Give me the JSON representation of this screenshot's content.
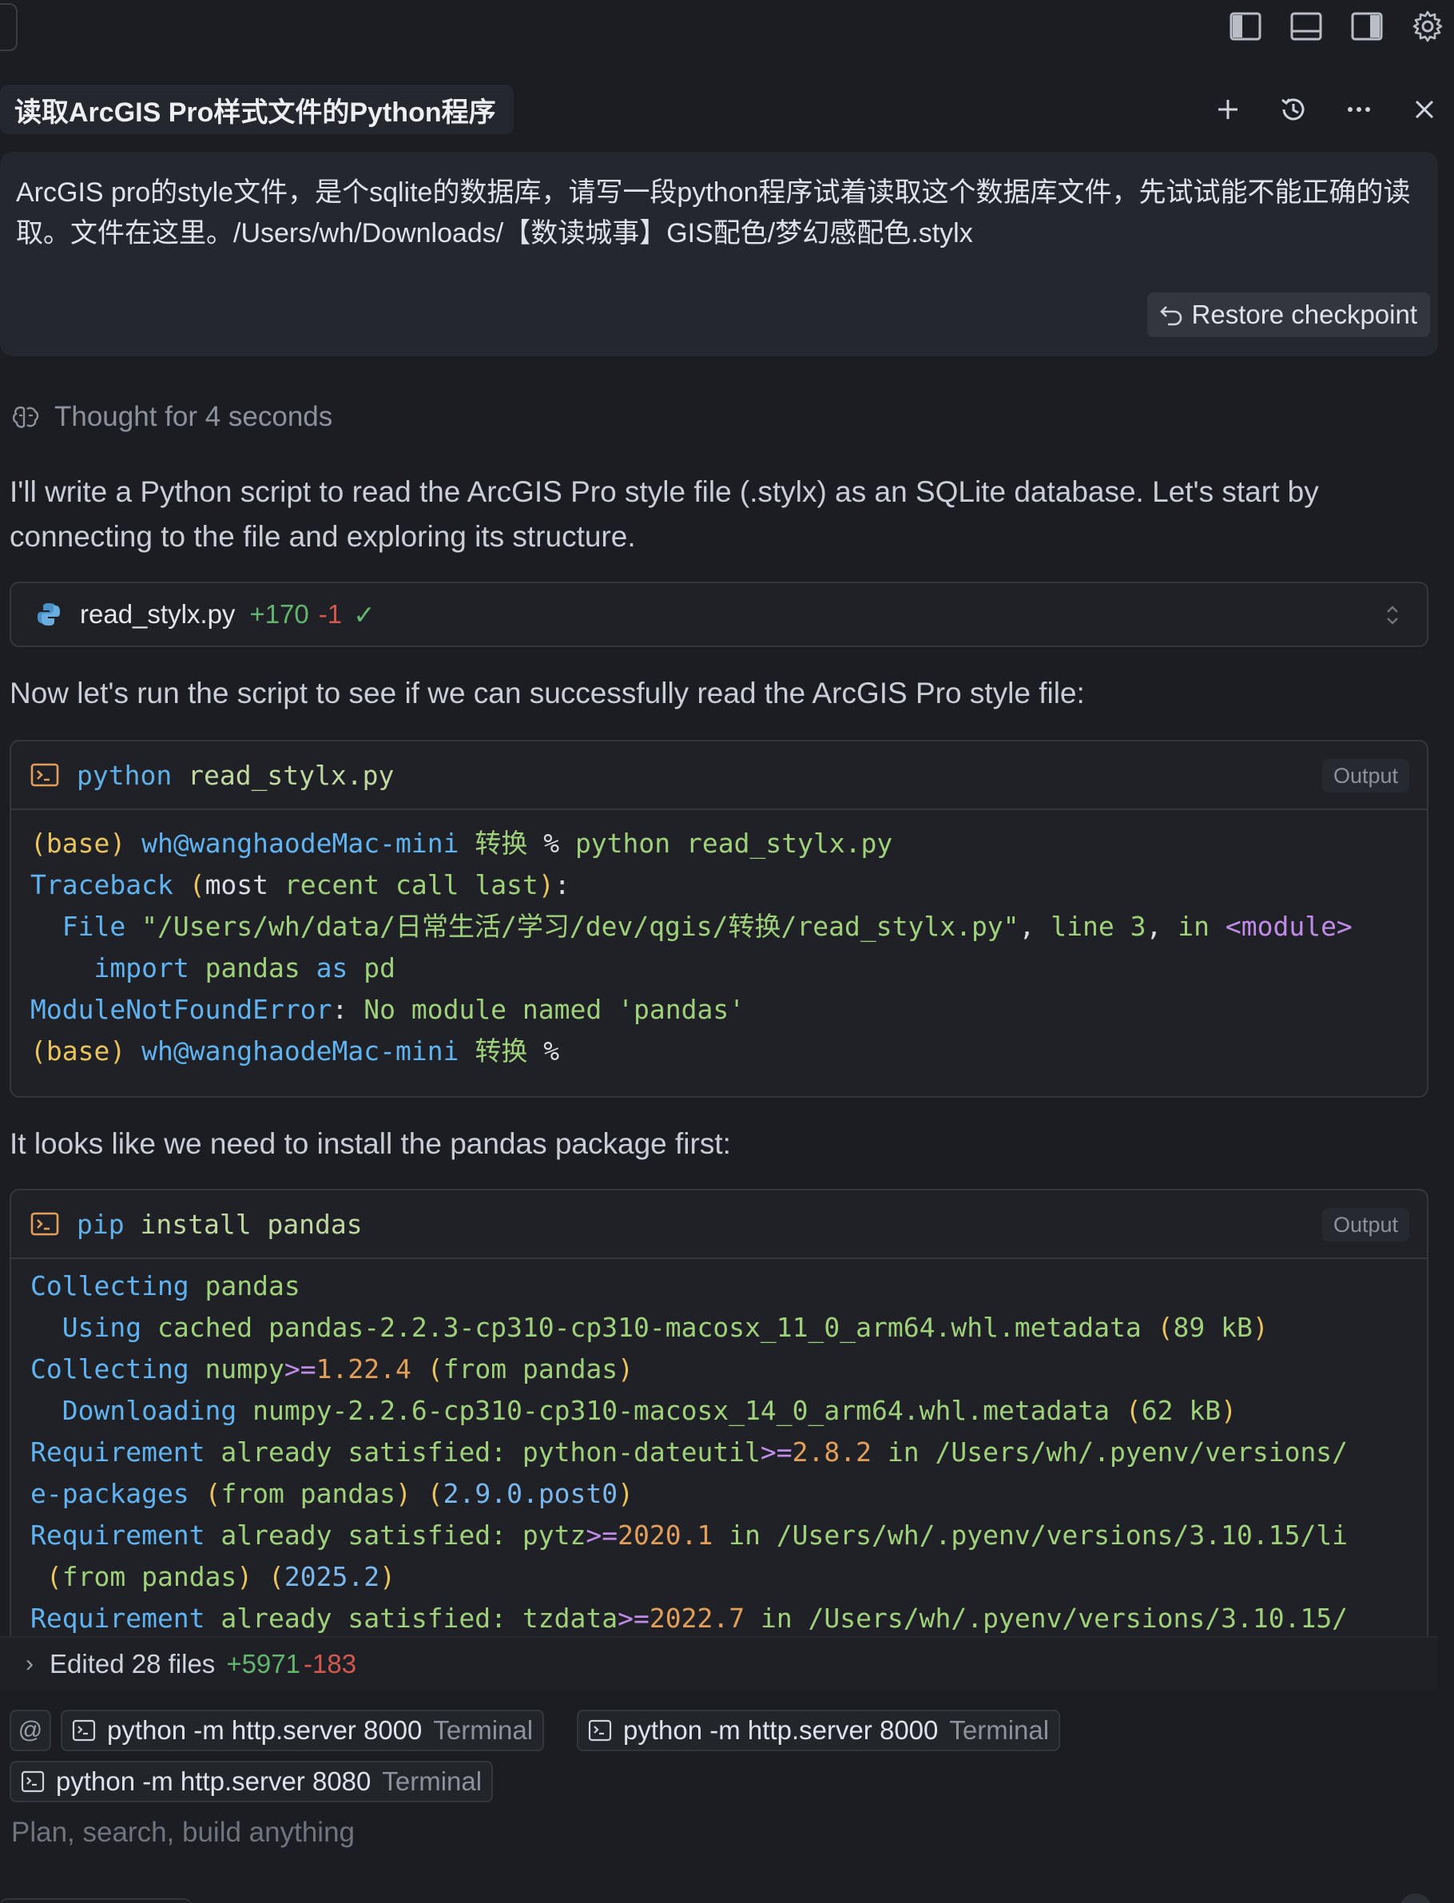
{
  "window": {
    "title": "读取ArcGIS Pro样式文件的Python程序",
    "top_icons": [
      "toggle-left-sidebar-icon",
      "toggle-bottom-panel-icon",
      "toggle-right-sidebar-icon",
      "settings-gear-icon"
    ],
    "title_actions": [
      "plus-icon",
      "history-icon",
      "more-icon",
      "close-icon"
    ]
  },
  "user_message": {
    "text": "ArcGIS pro的style文件，是个sqlite的数据库，请写一段python程序试着读取这个数据库文件，先试试能不能正确的读取。文件在这里。/Users/wh/Downloads/【数读城事】GIS配色/梦幻感配色.stylx",
    "restore_label": "Restore checkpoint"
  },
  "thought": {
    "label": "Thought for 4 seconds"
  },
  "messages": {
    "intro": "I'll write a Python script to read the ArcGIS Pro style file (.stylx) as an SQLite database. Let's start by connecting to the file and exploring its structure.",
    "run": "Now let's run the script to see if we can successfully read the ArcGIS Pro style file:",
    "install": "It looks like we need to install the pandas package first:"
  },
  "file_edit": {
    "name": "read_stylx.py",
    "added": "+170",
    "removed": "-1",
    "check": "✓"
  },
  "terminal1": {
    "command_prog": "python",
    "command_args": "read_stylx.py",
    "output_label": "Output",
    "lines": [
      [
        [
          "t-y",
          "(base)"
        ],
        [
          "t-w",
          " "
        ],
        [
          "t-b",
          "wh@wanghaodeMac-mini"
        ],
        [
          "t-w",
          " "
        ],
        [
          "t-g",
          "转换"
        ],
        [
          "t-w",
          " % "
        ],
        [
          "t-g",
          "python read_stylx.py"
        ]
      ],
      [
        [
          "t-b",
          "Traceback"
        ],
        [
          "t-w",
          " "
        ],
        [
          "t-y",
          "("
        ],
        [
          "t-w",
          "most"
        ],
        [
          "t-g",
          " recent call last"
        ],
        [
          "t-y",
          ")"
        ],
        [
          "t-w",
          ":"
        ]
      ],
      [
        [
          "t-w",
          "  "
        ],
        [
          "t-b",
          "File"
        ],
        [
          "t-g",
          " \"/Users/wh/data/日常生活/学习/dev/qgis/转换/read_stylx.py\""
        ],
        [
          "t-w",
          ","
        ],
        [
          "t-g",
          " line 3"
        ],
        [
          "t-w",
          ","
        ],
        [
          "t-g",
          " in "
        ],
        [
          "t-p",
          "<module>"
        ]
      ],
      [
        [
          "t-w",
          "    "
        ],
        [
          "t-b",
          "import"
        ],
        [
          "t-g",
          " pandas "
        ],
        [
          "t-b",
          "as"
        ],
        [
          "t-g",
          " pd"
        ]
      ],
      [
        [
          "t-b",
          "ModuleNotFoundError"
        ],
        [
          "t-w",
          ":"
        ],
        [
          "t-g",
          " No module named 'pandas'"
        ]
      ],
      [
        [
          "t-y",
          "(base)"
        ],
        [
          "t-w",
          " "
        ],
        [
          "t-b",
          "wh@wanghaodeMac-mini"
        ],
        [
          "t-w",
          " "
        ],
        [
          "t-g",
          "转换"
        ],
        [
          "t-w",
          " %"
        ]
      ]
    ]
  },
  "terminal2": {
    "command_prog": "pip",
    "command_args": "install pandas",
    "output_label": "Output",
    "lines": [
      [
        [
          "t-b",
          "Collecting"
        ],
        [
          "t-g",
          " pandas"
        ]
      ],
      [
        [
          "t-w",
          "  "
        ],
        [
          "t-b",
          "Using"
        ],
        [
          "t-g",
          " cached pandas-2.2.3-cp310-cp310-macosx_11_0_arm64.whl.metadata "
        ],
        [
          "t-y",
          "("
        ],
        [
          "t-g",
          "89 kB"
        ],
        [
          "t-y",
          ")"
        ]
      ],
      [
        [
          "t-b",
          "Collecting"
        ],
        [
          "t-g",
          " numpy"
        ],
        [
          "t-p",
          ">="
        ],
        [
          "t-o",
          "1.22.4"
        ],
        [
          "t-g",
          " "
        ],
        [
          "t-y",
          "("
        ],
        [
          "t-g",
          "from pandas"
        ],
        [
          "t-y",
          ")"
        ]
      ],
      [
        [
          "t-w",
          "  "
        ],
        [
          "t-b",
          "Downloading"
        ],
        [
          "t-g",
          " numpy-2.2.6-cp310-cp310-macosx_14_0_arm64.whl.metadata "
        ],
        [
          "t-y",
          "("
        ],
        [
          "t-g",
          "62 kB"
        ],
        [
          "t-y",
          ")"
        ]
      ],
      [
        [
          "t-b",
          "Requirement"
        ],
        [
          "t-g",
          " already satisfied: python-dateutil"
        ],
        [
          "t-p",
          ">="
        ],
        [
          "t-o",
          "2.8.2"
        ],
        [
          "t-g",
          " in /Users/wh/.pyenv/versions/"
        ]
      ],
      [
        [
          "t-b",
          "e-packages"
        ],
        [
          "t-g",
          " "
        ],
        [
          "t-y",
          "("
        ],
        [
          "t-g",
          "from pandas"
        ],
        [
          "t-y",
          ")"
        ],
        [
          "t-g",
          " "
        ],
        [
          "t-y",
          "("
        ],
        [
          "t-num",
          "2.9.0.post0"
        ],
        [
          "t-y",
          ")"
        ]
      ],
      [
        [
          "t-b",
          "Requirement"
        ],
        [
          "t-g",
          " already satisfied: pytz"
        ],
        [
          "t-p",
          ">="
        ],
        [
          "t-o",
          "2020.1"
        ],
        [
          "t-g",
          " in /Users/wh/.pyenv/versions/3.10.15/li"
        ]
      ],
      [
        [
          "t-w",
          " "
        ],
        [
          "t-y",
          "("
        ],
        [
          "t-g",
          "from pandas"
        ],
        [
          "t-y",
          ")"
        ],
        [
          "t-g",
          " "
        ],
        [
          "t-y",
          "("
        ],
        [
          "t-num",
          "2025.2"
        ],
        [
          "t-y",
          ")"
        ]
      ],
      [
        [
          "t-b",
          "Requirement"
        ],
        [
          "t-g",
          " already satisfied: tzdata"
        ],
        [
          "t-p",
          ">="
        ],
        [
          "t-o",
          "2022.7"
        ],
        [
          "t-g",
          " in /Users/wh/.pyenv/versions/3.10.15/"
        ]
      ]
    ]
  },
  "edited_files": {
    "label": "Edited 28 files",
    "added": "+5971",
    "removed": "-183"
  },
  "context_chips": [
    {
      "label": "python -m http.server 8000",
      "kind": "Terminal"
    },
    {
      "label": "python -m http.server 8000",
      "kind": "Terminal"
    },
    {
      "label": "python -m http.server 8080",
      "kind": "Terminal"
    }
  ],
  "composer": {
    "at_symbol": "@",
    "placeholder": "Plan, search, build anything"
  },
  "colors": {
    "background": "#1b1d22",
    "card": "#24272d",
    "added": "#63b56d",
    "removed": "#d3584e"
  }
}
